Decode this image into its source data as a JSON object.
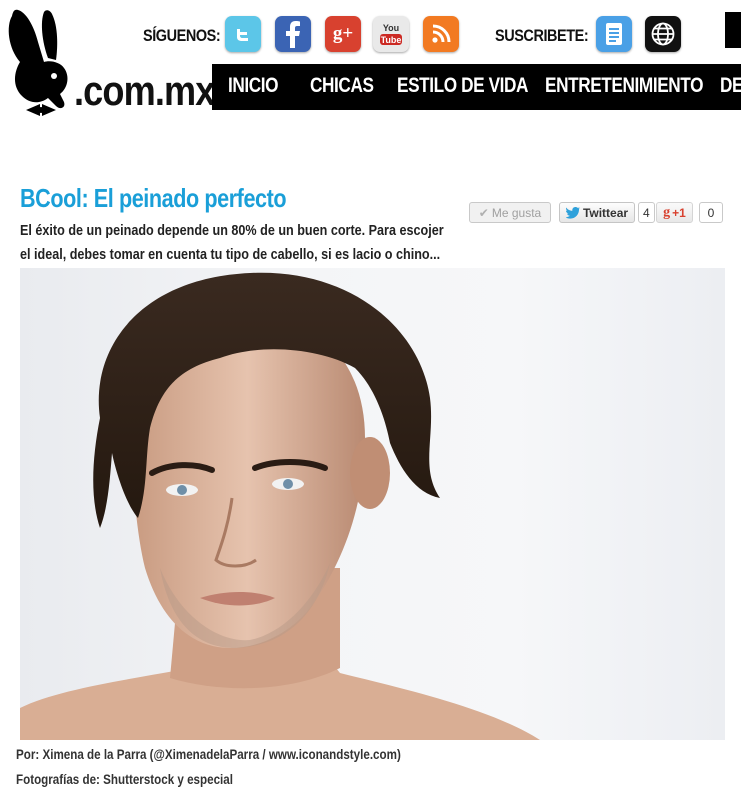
{
  "header": {
    "logo_text": ".com.mx",
    "follow_label": "SÍGUENOS:",
    "subscribe_label": "SUSCRIBETE:",
    "social_icons": [
      "twitter-icon",
      "facebook-icon",
      "google-plus-icon",
      "youtube-icon",
      "rss-icon"
    ],
    "subscribe_icons": [
      "newsletter-icon",
      "web-globe-icon"
    ],
    "youtube_glyph": "You\nTube",
    "colors": {
      "twitter": "#5cc6e8",
      "facebook": "#3b64b4",
      "google_plus": "#d8412f",
      "youtube_bg": "#e9e9e9",
      "youtube_red": "#cc2a24",
      "rss": "#f27a22",
      "newsletter": "#4aa0e6",
      "globe": "#111111"
    }
  },
  "nav": {
    "items": [
      "INICIO",
      "CHICAS",
      "ESTILO DE VIDA",
      "ENTRETENIMIENTO",
      "DE"
    ]
  },
  "article": {
    "title": "BCool: El peinado perfecto",
    "excerpt": "El éxito de un peinado depende un 80% de un buen corte. Para escojer el ideal, debes tomar en cuenta tu tipo de cabello, si es lacio o chino...",
    "credit_author": "Por: Ximena de la Parra (@XimenadelaParra / www.iconandstyle.com)",
    "credit_photos": "Fotografías de: Shutterstock y especial",
    "accent_color": "#1a9fd8"
  },
  "share": {
    "like_label": "Me gusta",
    "tweet_label": "Twittear",
    "tweet_count": "4",
    "gplus_label": "+1",
    "gplus_count": "0"
  }
}
